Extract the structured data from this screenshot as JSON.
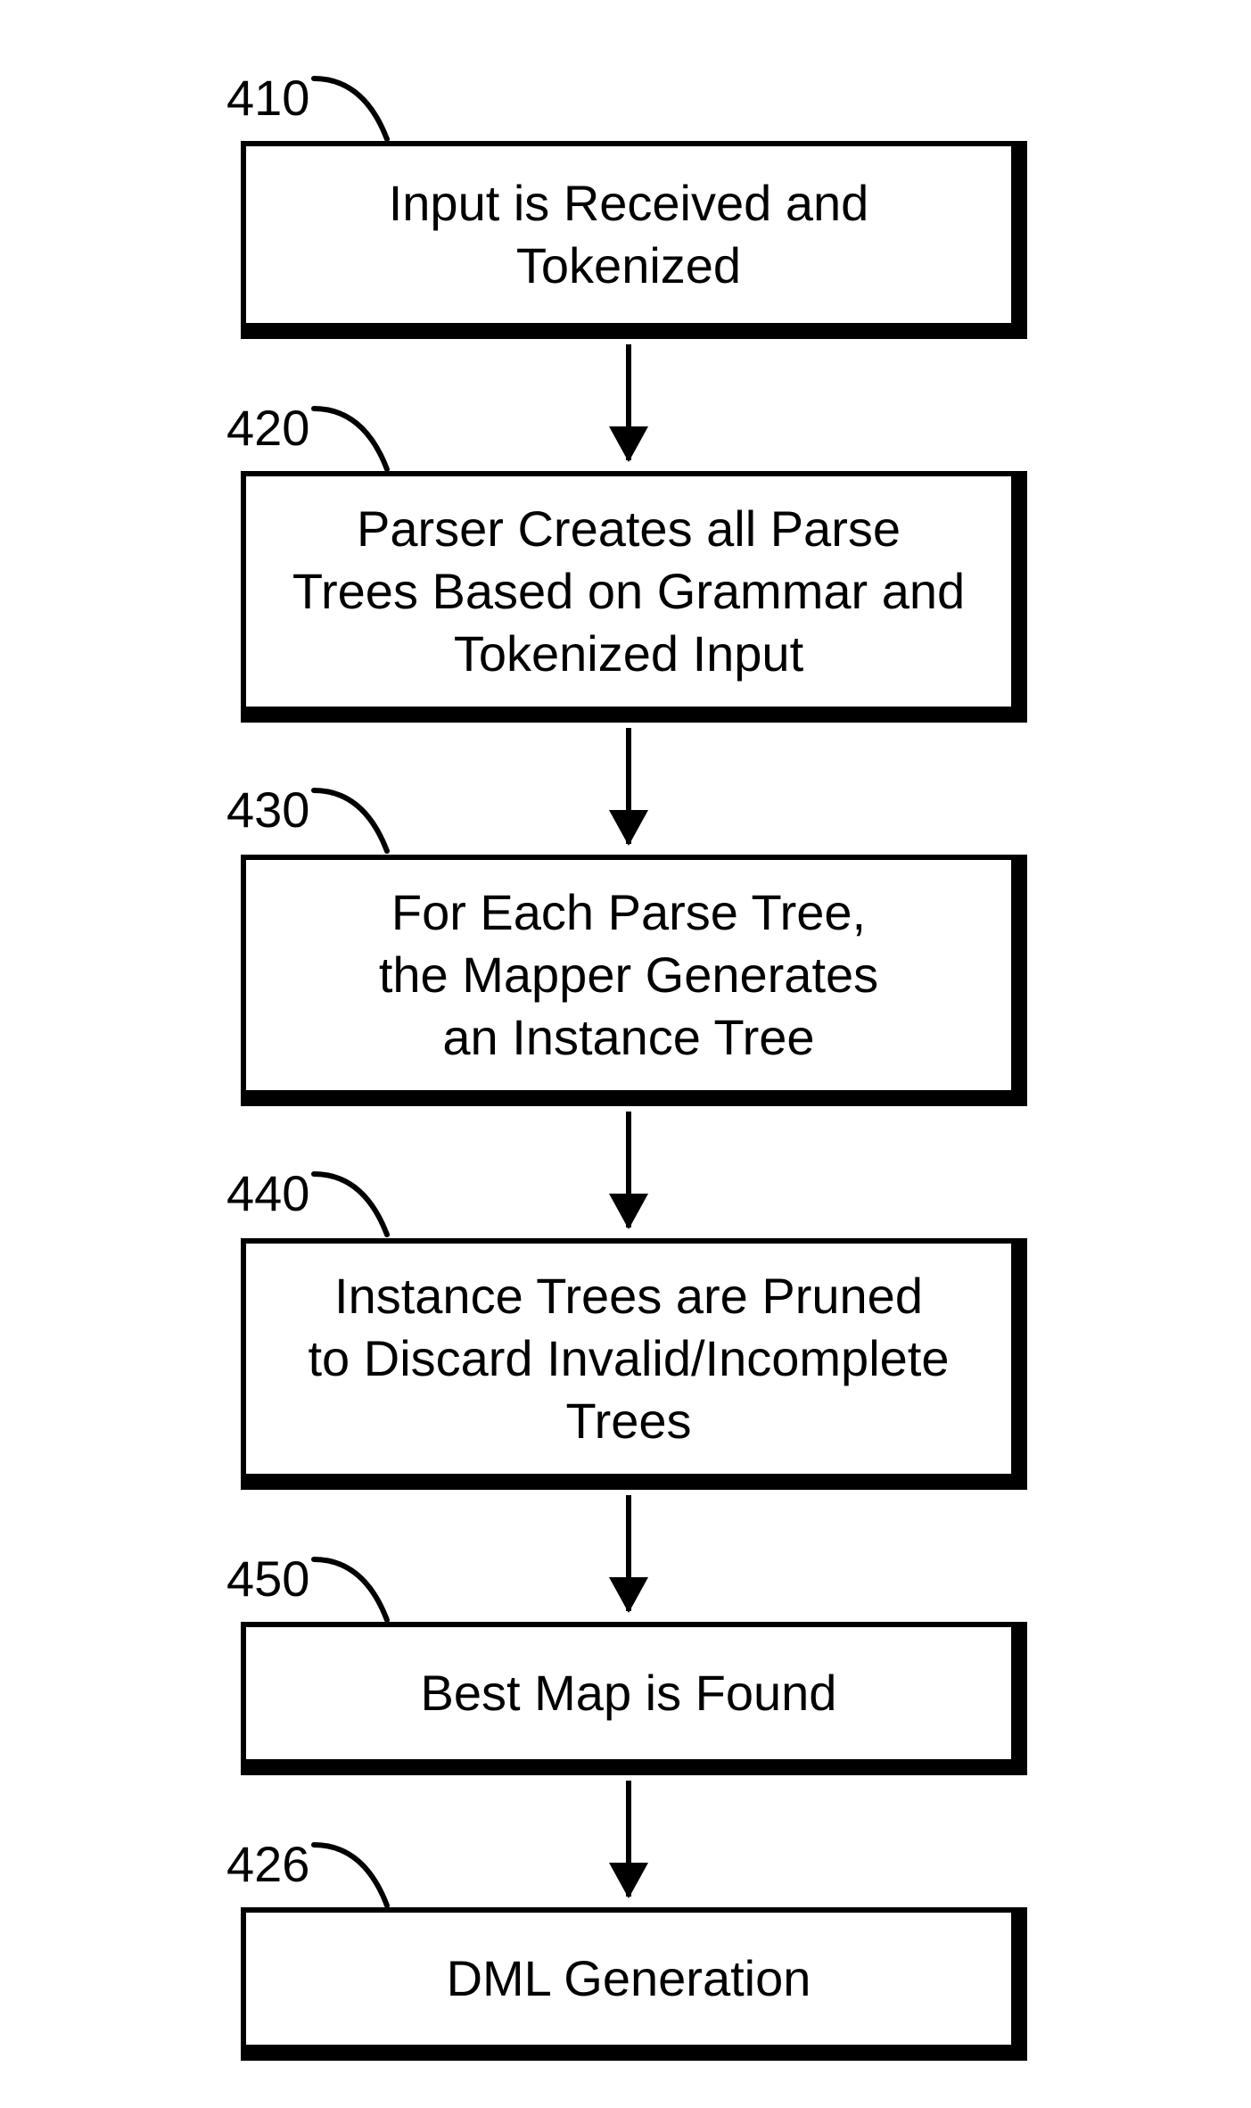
{
  "labels": {
    "l410": "410",
    "l420": "420",
    "l430": "430",
    "l440": "440",
    "l450": "450",
    "l426": "426"
  },
  "boxes": {
    "b410": "Input is Received and\nTokenized",
    "b420": "Parser Creates all Parse\nTrees Based on Grammar and\nTokenized Input",
    "b430": "For Each Parse Tree,\nthe Mapper Generates\nan Instance Tree",
    "b440": "Instance Trees are Pruned\nto Discard Invalid/Incomplete\nTrees",
    "b450": "Best Map is Found",
    "b426": "DML Generation"
  }
}
